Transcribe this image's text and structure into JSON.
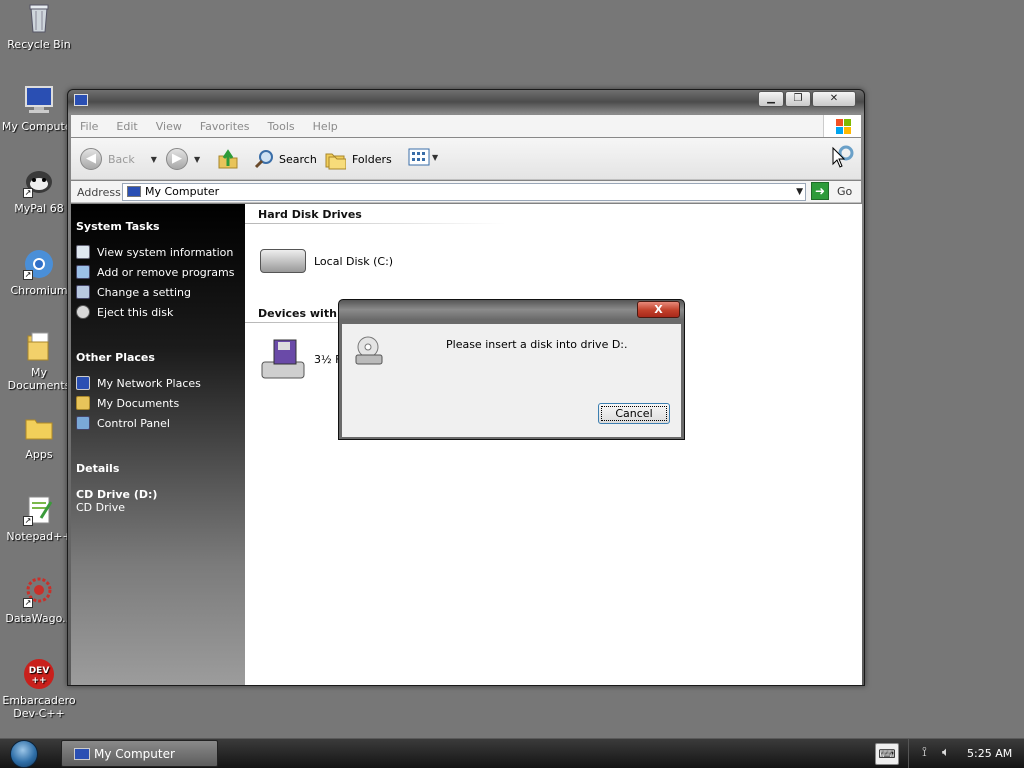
{
  "desktop": {
    "icons": [
      {
        "label": "Recycle Bin",
        "icon": "recycle-bin-icon"
      },
      {
        "label": "My Computer",
        "icon": "my-computer-icon"
      },
      {
        "label": "MyPal 68",
        "icon": "mypal-icon"
      },
      {
        "label": "Chromium",
        "icon": "chromium-icon"
      },
      {
        "label": "My Documents",
        "icon": "my-documents-icon"
      },
      {
        "label": "Apps",
        "icon": "folder-icon"
      },
      {
        "label": "Notepad++",
        "icon": "notepadpp-icon"
      },
      {
        "label": "DataWago...",
        "icon": "datawagon-icon"
      },
      {
        "label": "Embarcadero Dev-C++",
        "icon": "devcpp-icon"
      }
    ]
  },
  "window": {
    "menu": [
      "File",
      "Edit",
      "View",
      "Favorites",
      "Tools",
      "Help"
    ],
    "toolbar": {
      "back": "Back",
      "search": "Search",
      "folders": "Folders"
    },
    "address": {
      "label": "Address",
      "value": "My Computer",
      "go": "Go"
    },
    "sidebar": {
      "system_tasks_title": "System Tasks",
      "system_tasks": [
        "View system information",
        "Add or remove programs",
        "Change a setting",
        "Eject this disk"
      ],
      "other_places_title": "Other Places",
      "other_places": [
        "My Network Places",
        "My Documents",
        "Control Panel"
      ],
      "details_title": "Details",
      "details_name": "CD Drive (D:)",
      "details_type": "CD Drive"
    },
    "content": {
      "hard_disk_group": "Hard Disk Drives",
      "local_disk": "Local Disk (C:)",
      "removable_group": "Devices with Re",
      "floppy_label": "3½ F"
    }
  },
  "dialog": {
    "message": "Please insert a disk into drive D:.",
    "cancel": "Cancel",
    "close": "X"
  },
  "taskbar": {
    "task": "My Computer",
    "clock": "5:25 AM"
  },
  "colors": {
    "desktop_bg": "#777777",
    "sidebar_top": "#000000",
    "close_red": "#c2402a",
    "go_green": "#2d9b3a"
  }
}
